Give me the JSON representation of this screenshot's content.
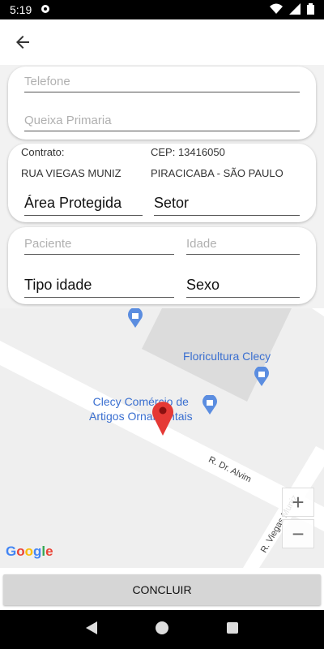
{
  "status_bar": {
    "time": "5:19"
  },
  "form": {
    "telefone_placeholder": "Telefone",
    "queixa_placeholder": "Queixa Primaria",
    "contrato_label": "Contrato:",
    "cep_label": "CEP: 13416050",
    "street": "RUA VIEGAS MUNIZ",
    "city": "PIRACICABA - SÃO PAULO",
    "area_protegida": "Área Protegida",
    "setor": "Setor",
    "paciente_placeholder": "Paciente",
    "idade_placeholder": "Idade",
    "tipo_idade": "Tipo idade",
    "sexo": "Sexo"
  },
  "map": {
    "place1": "Floricultura Clecy",
    "place2_line1": "Clecy Comércio de",
    "place2_line2": "Artigos Ornamentais",
    "road1": "R. Dr. Alvim",
    "road2": "R. Viegas Muniz",
    "zoom_in": "+",
    "zoom_out": "−",
    "google": "Google"
  },
  "footer": {
    "conclude_label": "CONCLUIR"
  }
}
